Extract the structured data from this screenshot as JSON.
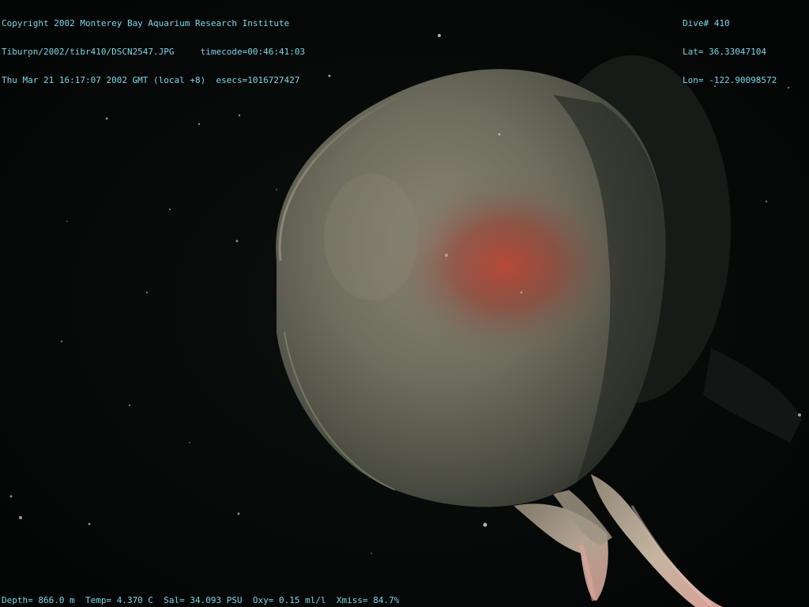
{
  "overlay": {
    "top_left": {
      "line1": "Copyright 2002 Monterey Bay Aquarium Research Institute",
      "line2": "Tiburon/2002/tibr410/DSCN2547.JPG     timecode=00:46:41:03",
      "line3": "Thu Mar 21 16:17:07 2002 GMT (local +8)  esecs=1016727427"
    },
    "top_right": {
      "line1": "Dive# 410",
      "line2": "Lat= 36.33047104",
      "line3": "Lon= -122.90098572"
    },
    "bottom": {
      "line": "Depth= 866.0 m  Temp= 4.370 C  Sal= 34.093 PSU  Oxy= 0.15 ml/l  Xmiss= 84.7%"
    }
  },
  "colors": {
    "overlay_text": "#7fd6e6",
    "background": "#050807",
    "bell_body": "#6e6c5e",
    "bell_glow": "#b83a2c",
    "tentacle": "#b9ab98"
  }
}
